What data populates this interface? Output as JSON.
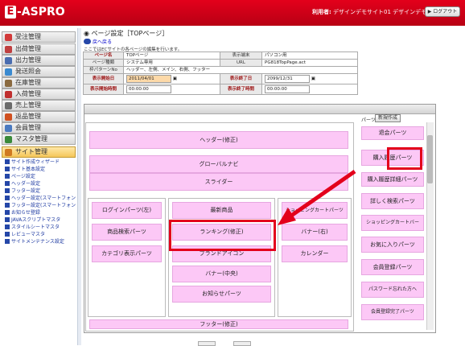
{
  "header": {
    "logo_mark": "E",
    "logo_text": "-ASPRO",
    "user_label": "利用者:",
    "user_name": "デザインデモサイト01 デザインデモサイト",
    "logout": "ログアウト"
  },
  "sidebar": {
    "items": [
      {
        "label": "受注管理",
        "icon_color": "#d23a3a"
      },
      {
        "label": "出荷管理",
        "icon_color": "#c04040"
      },
      {
        "label": "出力管理",
        "icon_color": "#4a6db0"
      },
      {
        "label": "発送照会",
        "icon_color": "#3a8ad0"
      },
      {
        "label": "在庫管理",
        "icon_color": "#8a6a40"
      },
      {
        "label": "入荷管理",
        "icon_color": "#c03030"
      },
      {
        "label": "売上管理",
        "icon_color": "#6a6a6a"
      },
      {
        "label": "返品管理",
        "icon_color": "#d05020"
      },
      {
        "label": "会員管理",
        "icon_color": "#4a7ac0"
      },
      {
        "label": "マスタ管理",
        "icon_color": "#3a8a3a"
      },
      {
        "label": "サイト管理",
        "icon_color": "#d07a20"
      }
    ],
    "subitems": [
      "サイト作成ウィザード",
      "サイト基本設定",
      "ページ設定",
      "ヘッダー設定",
      "フッター設定",
      "ヘッダー設定(スマートフォン",
      "フッター設定(スマートフォン",
      "お知らせ登録",
      "JAVAスクリプトマスタ",
      "スタイルシートマスタ",
      "レビューマスタ",
      "サイトメンテナンス設定"
    ]
  },
  "page": {
    "title": "ページ設定［TOPページ］",
    "back": "戻へ戻る",
    "desc": "ここではECサイトの各ページの編集を行います。"
  },
  "info": {
    "page_name_label": "ページ名",
    "page_name": "TOPページ",
    "device_label": "表示端末",
    "device": "パソコン用",
    "kind_label": "ページ種類",
    "kind": "システム専用",
    "url_label": "URL",
    "url": "PG818TopPage.act",
    "frame_label": "枠パターンNo",
    "frame": "ヘッダー、左側、メイン、右側、フッター",
    "start_date_label": "表示開始日",
    "start_date": "2011/04/01",
    "end_date_label": "表示終了日",
    "end_date": "2099/12/31",
    "start_time_label": "表示開始時間",
    "start_time": "00:00:00",
    "end_time_label": "表示終了時間",
    "end_time": "00:00:00"
  },
  "editor": {
    "parts_label": "パーツ",
    "new_button": "新規作成",
    "header_blocks": [
      "ヘッダー(修正)",
      "グローバルナビ",
      "スライダー"
    ],
    "left_blocks": [
      "ログインパーツ(左)",
      "商品検索パーツ",
      "カテゴリ表示パーツ"
    ],
    "center_blocks": [
      "最新商品",
      "ランキング(修正)",
      "ブランドアイコン",
      "バナー(中央)",
      "お知らせパーツ"
    ],
    "right_blocks": [
      "ショッピングカートパーツ",
      "バナー(右)",
      "カレンダー"
    ],
    "footer": "フッター(修正)",
    "palette": [
      "退会パーツ",
      "購入履歴パーツ",
      "購入履歴詳細パーツ",
      "詳しく検索パーツ",
      "ショッピングカートバー",
      "お気に入りパーツ",
      "会員登録パーツ",
      "パスワード忘れた方へ",
      "会員登録完了パーツ"
    ]
  },
  "colors": {
    "header_red": "#d0001a",
    "part_pink": "#fcc8f6",
    "highlight_red": "#e3001b"
  }
}
